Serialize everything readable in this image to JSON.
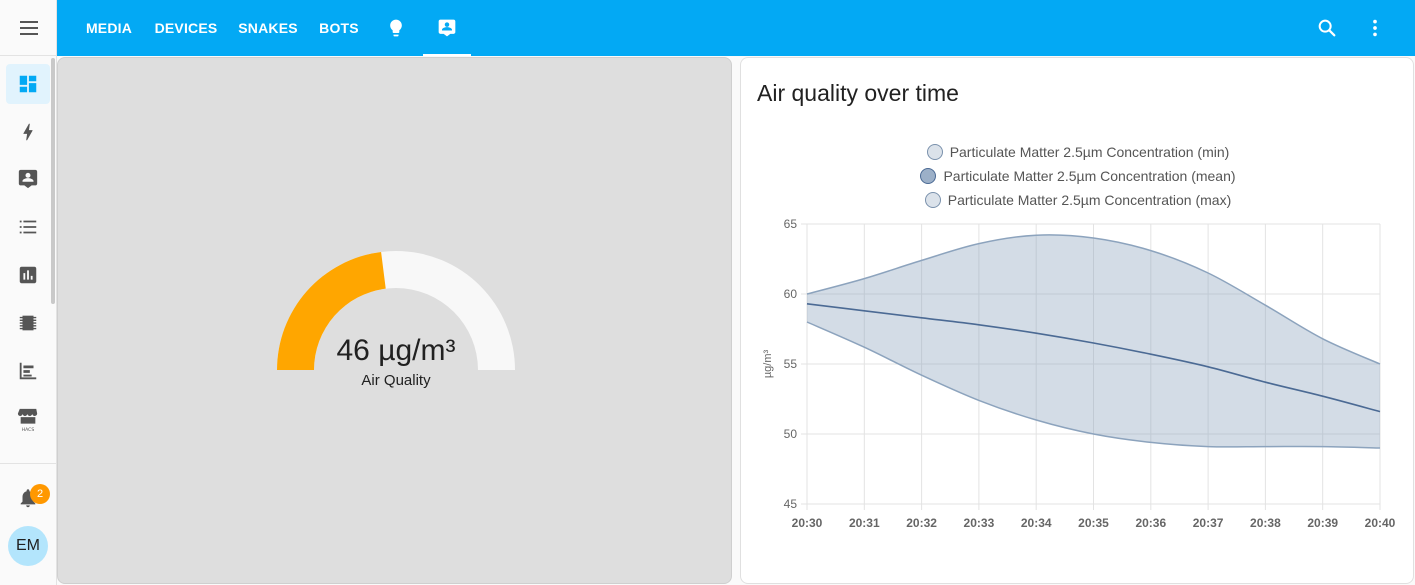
{
  "topbar": {
    "tabs": [
      {
        "label": "MEDIA"
      },
      {
        "label": "DEVICES"
      },
      {
        "label": "SNAKES"
      },
      {
        "label": "BOTS"
      }
    ],
    "icon_tabs": [
      "lightbulb-icon",
      "account-box-icon"
    ],
    "actions": [
      "search-icon",
      "dots-vertical-icon"
    ],
    "color": "#03a9f4"
  },
  "sidebar": {
    "items": [
      "dashboard-icon",
      "energy-icon",
      "account-box-icon",
      "list-icon",
      "chart-icon",
      "chip-icon",
      "history-icon",
      "hacs-icon"
    ],
    "notifications_count": "2",
    "user_initials": "EM",
    "accent": "#03a9f4"
  },
  "gauge": {
    "value_text": "46 µg/m³",
    "name": "Air Quality",
    "fraction": 0.46,
    "color": "#ffa600"
  },
  "chart_card": {
    "title": "Air quality over time"
  },
  "chart_data": {
    "type": "area",
    "title": "Air quality over time",
    "ylabel": "µg/m³",
    "xlabel": "",
    "ylim": [
      45,
      65
    ],
    "yticks": [
      "45",
      "50",
      "55",
      "60",
      "65"
    ],
    "x": [
      "20:30",
      "20:31",
      "20:32",
      "20:33",
      "20:34",
      "20:35",
      "20:36",
      "20:37",
      "20:38",
      "20:39",
      "20:40"
    ],
    "legend_position": "top",
    "grid": true,
    "series": [
      {
        "name": "Particulate Matter 2.5µm Concentration (min)",
        "color": "#8ca3bd",
        "values": [
          58.0,
          56.2,
          54.2,
          52.4,
          51.0,
          50.0,
          49.4,
          49.1,
          49.1,
          49.1,
          49.0
        ]
      },
      {
        "name": "Particulate Matter 2.5µm Concentration (mean)",
        "color": "#4b6a94",
        "values": [
          59.3,
          58.8,
          58.3,
          57.8,
          57.2,
          56.5,
          55.7,
          54.8,
          53.7,
          52.7,
          51.6
        ]
      },
      {
        "name": "Particulate Matter 2.5µm Concentration (max)",
        "color": "#8ca3bd",
        "values": [
          60.0,
          61.1,
          62.4,
          63.6,
          64.2,
          64.0,
          63.1,
          61.5,
          59.2,
          56.8,
          55.0
        ]
      }
    ]
  }
}
